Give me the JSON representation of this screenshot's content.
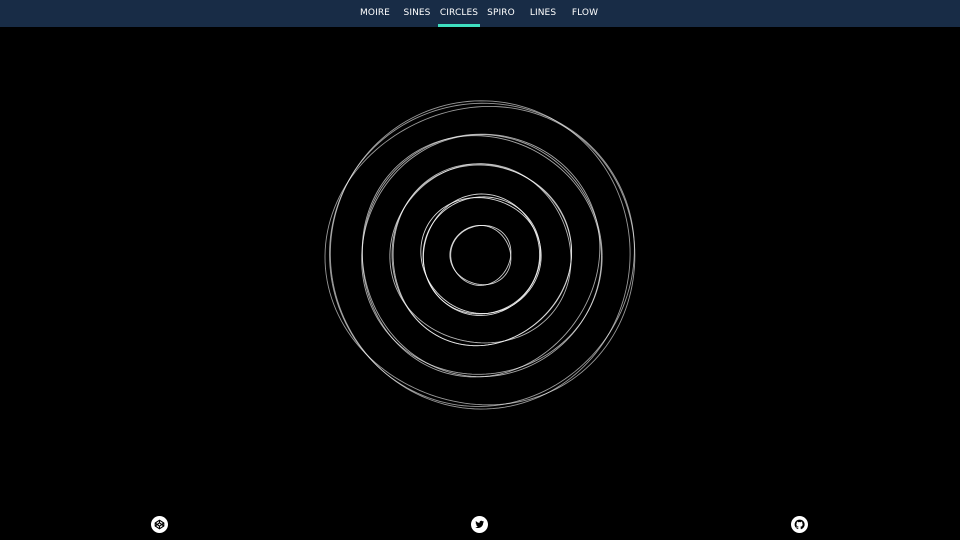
{
  "nav": {
    "items": [
      {
        "label": "MOIRE",
        "active": false
      },
      {
        "label": "SINES",
        "active": false
      },
      {
        "label": "CIRCLES",
        "active": true
      },
      {
        "label": "SPIRO",
        "active": false
      },
      {
        "label": "LINES",
        "active": false
      },
      {
        "label": "FLOW",
        "active": false
      }
    ]
  },
  "colors": {
    "nav_background": "#182c46",
    "nav_text": "#ffffff",
    "active_indicator": "#3fdfc0",
    "canvas_background": "#000000",
    "stroke": "#ffffff"
  },
  "social": {
    "items": [
      {
        "icon": "codepen-icon"
      },
      {
        "icon": "twitter-icon"
      },
      {
        "icon": "github-icon"
      }
    ]
  }
}
